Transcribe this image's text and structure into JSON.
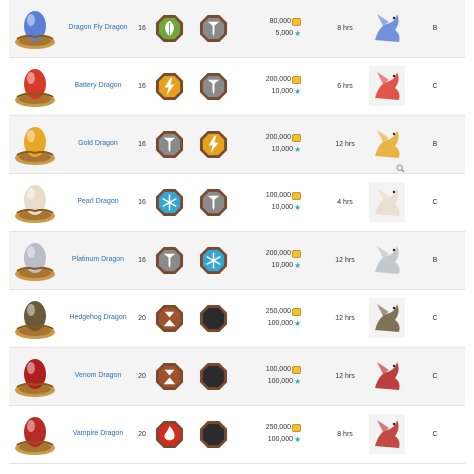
{
  "dragons": [
    {
      "name": "Dragon Fly Dragon",
      "level": "16",
      "elements": [
        "nature",
        "metal"
      ],
      "gold": "80,000",
      "gems": "5,000",
      "time": "8 hrs",
      "rarity": "B",
      "egg_color": "#5a7fd8"
    },
    {
      "name": "Battery Dragon",
      "level": "16",
      "elements": [
        "electric",
        "metal"
      ],
      "gold": "200,000",
      "gems": "10,000",
      "time": "6 hrs",
      "rarity": "C",
      "egg_color": "#d83a2a"
    },
    {
      "name": "Gold Dragon",
      "level": "16",
      "elements": [
        "metal",
        "electric"
      ],
      "gold": "200,000",
      "gems": "10,000",
      "time": "12 hrs",
      "rarity": "B",
      "egg_color": "#e7a826"
    },
    {
      "name": "Pearl Dragon",
      "level": "16",
      "elements": [
        "ice",
        "metal"
      ],
      "gold": "100,000",
      "gems": "10,000",
      "time": "4 hrs",
      "rarity": "C",
      "egg_color": "#e8dccb"
    },
    {
      "name": "Platinum Dragon",
      "level": "16",
      "elements": [
        "metal",
        "ice"
      ],
      "gold": "200,000",
      "gems": "10,000",
      "time": "12 hrs",
      "rarity": "B",
      "egg_color": "#b8bfc6"
    },
    {
      "name": "Hedgehog Dragon",
      "level": "20",
      "elements": [
        "earth",
        "dark"
      ],
      "gold": "250,000",
      "gems": "100,000",
      "time": "12 hrs",
      "rarity": "C",
      "egg_color": "#6a5a3a"
    },
    {
      "name": "Venom Dragon",
      "level": "20",
      "elements": [
        "earth",
        "dark"
      ],
      "gold": "100,000",
      "gems": "100,000",
      "time": "12 hrs",
      "rarity": "C",
      "egg_color": "#b01f1f"
    },
    {
      "name": "Vampire Dragon",
      "level": "20",
      "elements": [
        "fire",
        "dark"
      ],
      "gold": "250,000",
      "gems": "100,000",
      "time": "8 hrs",
      "rarity": "C",
      "egg_color": "#b82a24"
    }
  ],
  "colors": {
    "link": "#2a6fb0",
    "row_alt": "#f4f4f4",
    "badge_frame": "#7a4a2e",
    "nature": "#6fa83a",
    "electric": "#e5a21e",
    "metal": "#8a8a8a",
    "ice": "#33a6d6",
    "earth": "#a0522d",
    "dark": "#2b2b2b",
    "fire": "#d92a1f",
    "coin": "#f2c230",
    "gem": "#34a9b8"
  }
}
